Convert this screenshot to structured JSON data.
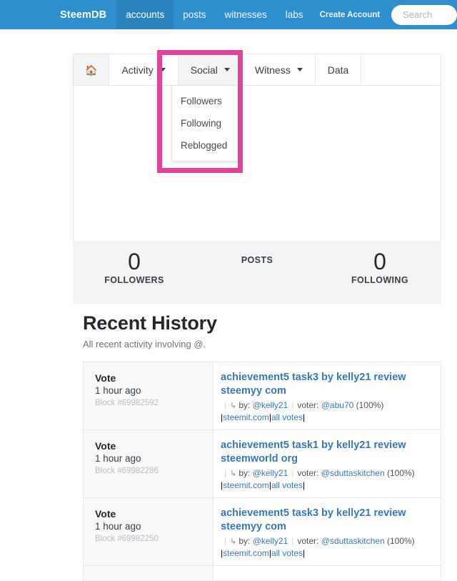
{
  "navbar": {
    "brand": "SteemDB",
    "items": [
      {
        "label": "accounts",
        "active": true
      },
      {
        "label": "posts",
        "active": false
      },
      {
        "label": "witnesses",
        "active": false
      },
      {
        "label": "labs",
        "active": false
      }
    ],
    "create_account": "Create Account",
    "search_placeholder": "Search",
    "background_color": "#2f8fce",
    "active_color": "#2b83bd"
  },
  "tabs": {
    "home_icon": "home-icon",
    "items": [
      {
        "label": "Activity",
        "has_caret": true,
        "active": false
      },
      {
        "label": "Social",
        "has_caret": true,
        "active": true
      },
      {
        "label": "Witness",
        "has_caret": true,
        "active": false
      },
      {
        "label": "Data",
        "has_caret": false,
        "active": false
      }
    ]
  },
  "dropdown": {
    "open_for": "Social",
    "items": [
      {
        "label": "Followers"
      },
      {
        "label": "Following"
      },
      {
        "label": "Reblogged"
      }
    ]
  },
  "highlight": {
    "color": "#e0449a",
    "target": "social-dropdown"
  },
  "stats": [
    {
      "key": "followers",
      "value": "0",
      "label": "FOLLOWERS"
    },
    {
      "key": "posts",
      "value": "",
      "label": "POSTS"
    },
    {
      "key": "following",
      "value": "0",
      "label": "FOLLOWING"
    }
  ],
  "history": {
    "title": "Recent History",
    "subtitle": "All recent activity involving @.",
    "rows": [
      {
        "type": "Vote",
        "time": "1 hour ago",
        "block": "Block #69982592",
        "title": "achievement5 task3 by kelly21 review steemyy com",
        "by_label": "by:",
        "by": "@kelly21",
        "voter_label": "voter:",
        "voter": "@abu70",
        "weight": "(100%)",
        "link1": "steemit.com",
        "link2": "all votes"
      },
      {
        "type": "Vote",
        "time": "1 hour ago",
        "block": "Block #69982286",
        "title": "achievement5 task1 by kelly21 review steemworld org",
        "by_label": "by:",
        "by": "@kelly21",
        "voter_label": "voter:",
        "voter": "@sduttaskitchen",
        "weight": "(100%)",
        "link1": "steemit.com",
        "link2": "all votes"
      },
      {
        "type": "Vote",
        "time": "1 hour ago",
        "block": "Block #69982250",
        "title": "achievement5 task3 by kelly21 review steemyy com",
        "by_label": "by:",
        "by": "@kelly21",
        "voter_label": "voter:",
        "voter": "@sduttaskitchen",
        "weight": "(100%)",
        "link1": "steemit.com",
        "link2": "all votes"
      },
      {
        "type": "",
        "time": "",
        "block": "",
        "title": "",
        "by_label": "",
        "by": "",
        "voter_label": "",
        "voter": "",
        "weight": "",
        "link1": "",
        "link2": ""
      }
    ]
  }
}
